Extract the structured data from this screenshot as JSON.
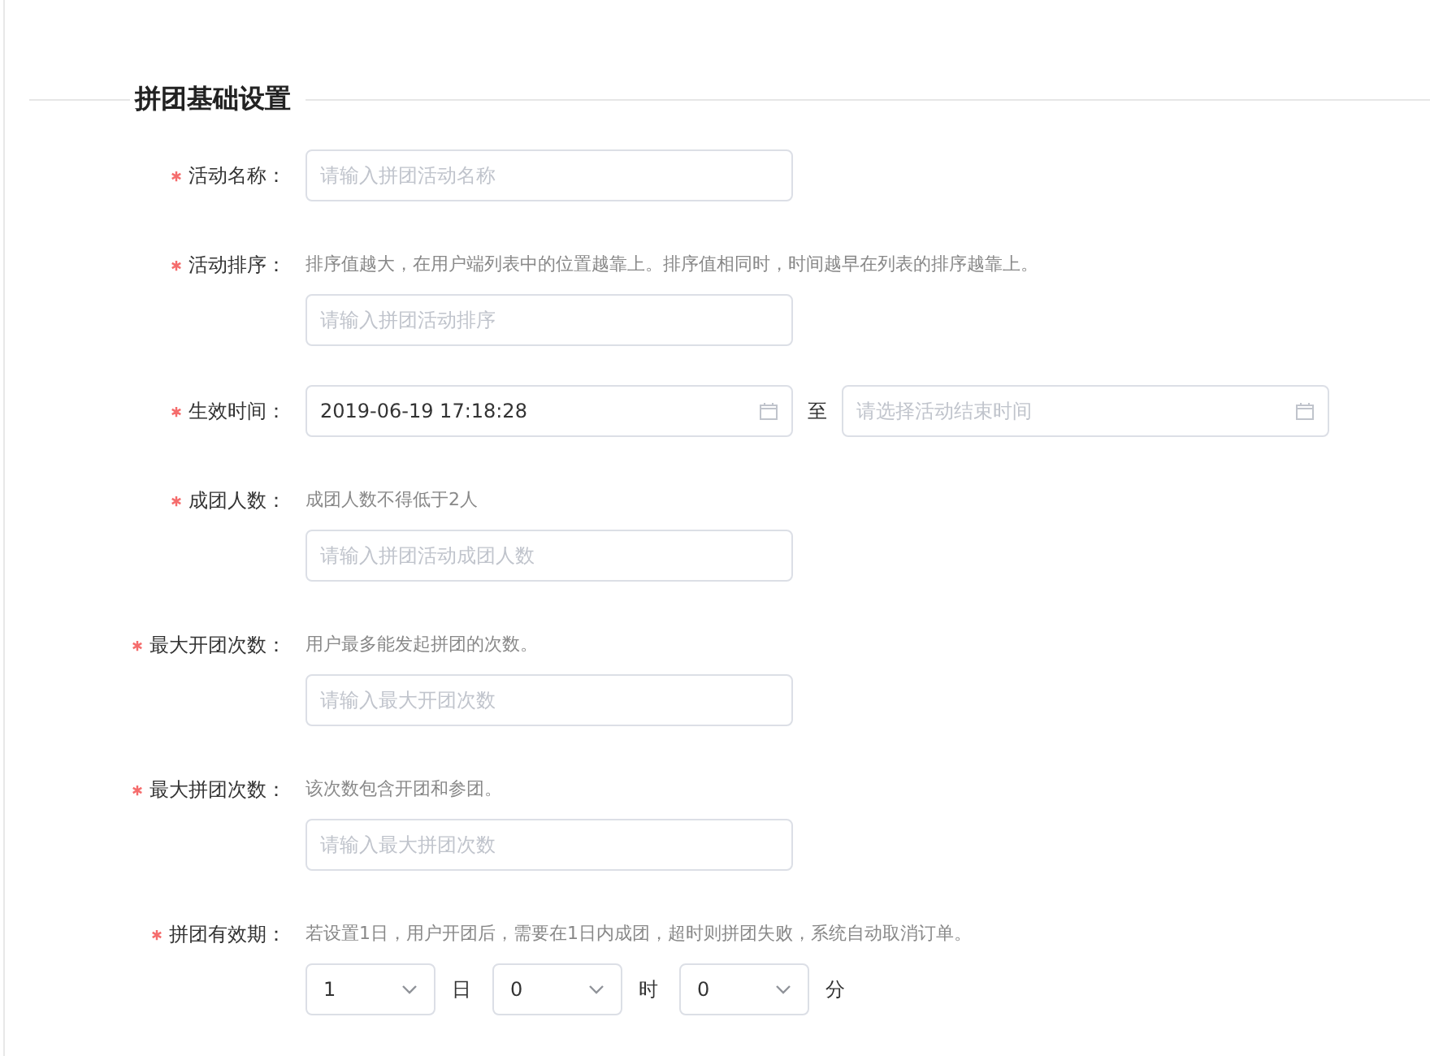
{
  "section": {
    "title": "拼团基础设置"
  },
  "fields": [
    {
      "kind": "input",
      "required": true,
      "label": "活动名称：",
      "placeholder": "请输入拼团活动名称"
    },
    {
      "kind": "input",
      "required": true,
      "label": "活动排序：",
      "hint": "排序值越大，在用户端列表中的位置越靠上。排序值相同时，时间越早在列表的排序越靠上。",
      "placeholder": "请输入拼团活动排序"
    },
    {
      "kind": "daterange",
      "required": true,
      "label": "生效时间：",
      "start": {
        "value": "2019-06-19 17:18:28"
      },
      "separator": "至",
      "end": {
        "placeholder": "请选择活动结束时间"
      }
    },
    {
      "kind": "input",
      "required": true,
      "label": "成团人数：",
      "hint": "成团人数不得低于2人",
      "placeholder": "请输入拼团活动成团人数"
    },
    {
      "kind": "input",
      "required": true,
      "label": "最大开团次数：",
      "hint": "用户最多能发起拼团的次数。",
      "placeholder": "请输入最大开团次数"
    },
    {
      "kind": "input",
      "required": true,
      "label": "最大拼团次数：",
      "hint": "该次数包含开团和参团。",
      "placeholder": "请输入最大拼团次数"
    },
    {
      "kind": "duration",
      "required": true,
      "label": "拼团有效期：",
      "hint": "若设置1日，用户开团后，需要在1日内成团，超时则拼团失败，系统自动取消订单。",
      "selects": [
        {
          "value": "1",
          "unit": "日"
        },
        {
          "value": "0",
          "unit": "时"
        },
        {
          "value": "0",
          "unit": "分"
        }
      ]
    }
  ]
}
